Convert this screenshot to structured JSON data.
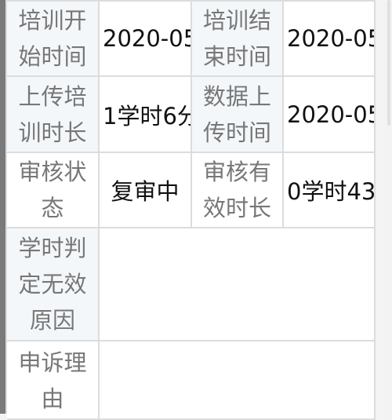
{
  "rows": [
    {
      "label1": "培训开始时间",
      "value1": "2020-05",
      "label2": "培训结束时间",
      "value2": "2020-05"
    },
    {
      "label1": "上传培训时长",
      "value1": "1学时6分",
      "label2": "数据上传时间",
      "value2": "2020-05"
    },
    {
      "label1": "审核状态",
      "value1": "复审中",
      "label2": "审核有效时长",
      "value2": "0学时43"
    }
  ],
  "invalid_reason": {
    "label": "学时判定无效原因",
    "value": ""
  },
  "appeal_reason": {
    "label": "申诉理由",
    "value": ""
  }
}
